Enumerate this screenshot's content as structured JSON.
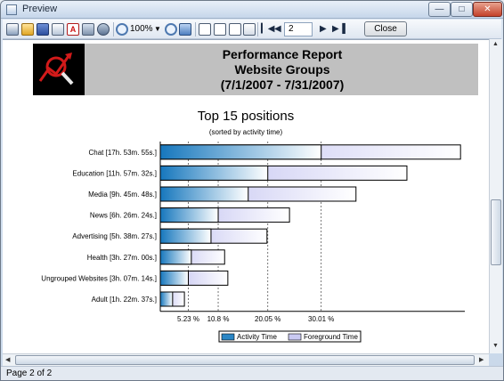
{
  "window": {
    "title": "Preview"
  },
  "toolbar": {
    "zoom_value": "100%",
    "page_value": "2",
    "close_label": "Close",
    "icons": [
      "print-icon",
      "open-icon",
      "save-icon",
      "export-icon",
      "pdf-icon",
      "setup-icon",
      "find-icon",
      "zoom-in-icon",
      "zoom-out-icon",
      "fit-icon",
      "single-page-icon",
      "two-page-icon",
      "multi-page-icon",
      "edit-icon",
      "first-page-icon",
      "prev-page-icon",
      "next-page-icon",
      "last-page-icon"
    ]
  },
  "report": {
    "title": "Performance Report",
    "subtitle": "Website Groups",
    "period": "(7/1/2007 - 7/31/2007)"
  },
  "chart": {
    "title": "Top 15 positions",
    "subtitle": "(sorted by activity time)"
  },
  "chart_data": {
    "type": "bar",
    "orientation": "horizontal",
    "categories": [
      "Chat [17h. 53m. 55s.]",
      "Education [11h. 57m. 32s.]",
      "Media [9h. 45m. 48s.]",
      "News [6h. 26m. 24s.]",
      "Advertising [5h. 38m. 27s.]",
      "Health [3h. 27m. 00s.]",
      "Ungrouped Websites [3h. 07m. 14s.]",
      "Adult [1h. 22m. 37s.]"
    ],
    "series": [
      {
        "name": "Activity Time",
        "values": [
          30.01,
          20.05,
          16.4,
          10.8,
          9.46,
          5.79,
          5.23,
          2.3
        ],
        "color": "#2b86c5"
      },
      {
        "name": "Foreground Time",
        "values": [
          56.0,
          46.0,
          36.5,
          24.1,
          19.9,
          12.0,
          12.6,
          4.5
        ],
        "color": "#c9c9f2"
      }
    ],
    "xticks": [
      "5.23 %",
      "10.8 %",
      "20.05 %",
      "30.01 %"
    ],
    "xtick_values": [
      5.23,
      10.8,
      20.05,
      30.01
    ],
    "xlim": [
      0,
      56.8
    ],
    "legend_position": "bottom"
  },
  "status": {
    "text": "Page 2 of 2"
  }
}
